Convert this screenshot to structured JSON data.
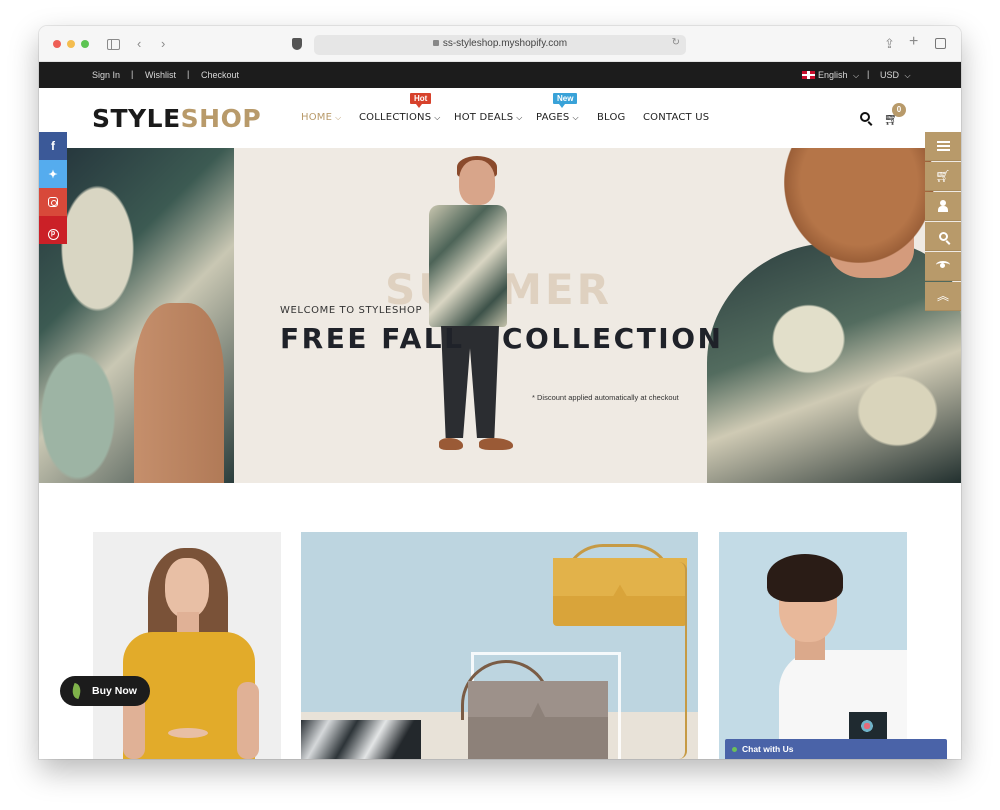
{
  "browser": {
    "url": "ss-styleshop.myshopify.com"
  },
  "topbar": {
    "links": [
      "Sign In",
      "Wishlist",
      "Checkout"
    ],
    "separator": "|",
    "language": "English",
    "currency": "USD"
  },
  "header": {
    "logo_part1": "STYLE",
    "logo_part2": "SHOP",
    "menu": [
      {
        "label": "HOME",
        "active": true,
        "dropdown": true
      },
      {
        "label": "COLLECTIONS",
        "dropdown": true,
        "badge": "Hot"
      },
      {
        "label": "HOT DEALS",
        "dropdown": true
      },
      {
        "label": "PAGES",
        "dropdown": true,
        "badge": "New"
      },
      {
        "label": "BLOG"
      },
      {
        "label": "CONTACT US"
      }
    ],
    "chevron": "⌵",
    "cart_count": "0"
  },
  "hero": {
    "background_word": "SUMMER",
    "welcome": "WELCOME TO STYLESHOP",
    "title_part1": "FREE FALL",
    "title_part2": "COLLECTION",
    "note": "* Discount applied automatically at checkout"
  },
  "social": [
    {
      "name": "facebook",
      "glyph": "f"
    },
    {
      "name": "twitter",
      "glyph": "🐦"
    },
    {
      "name": "instagram",
      "glyph": ""
    },
    {
      "name": "pinterest",
      "glyph": "p"
    }
  ],
  "tools": [
    "menu",
    "cart",
    "account",
    "search",
    "compare",
    "back-to-top"
  ],
  "widgets": {
    "buy_now": "Buy Now",
    "chat": "Chat with Us"
  },
  "colors": {
    "accent": "#b89a6a",
    "topbar": "#1c1c1c",
    "hot_badge": "#d7422c",
    "new_badge": "#39a2d8",
    "chat": "#4a63a8"
  }
}
